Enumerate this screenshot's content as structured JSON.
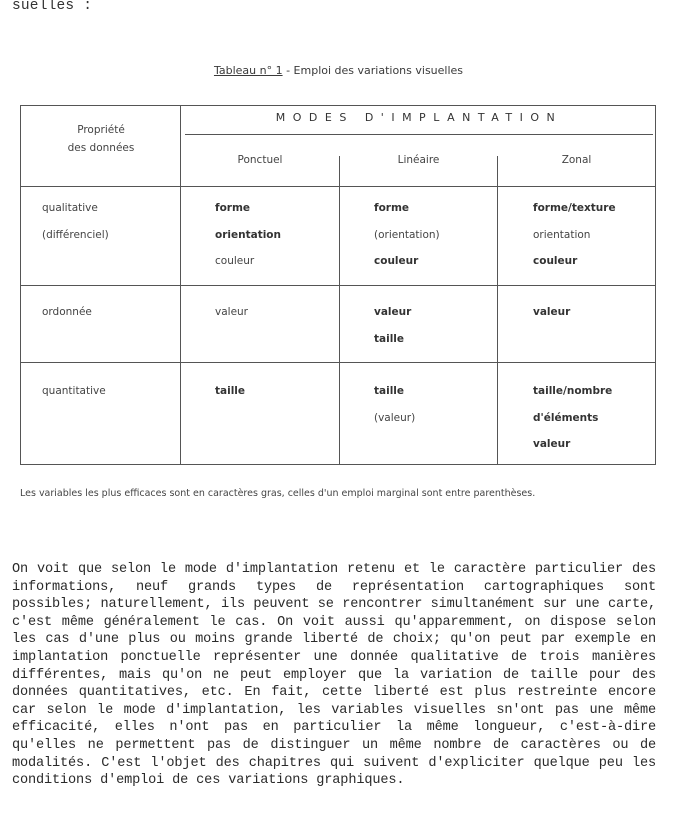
{
  "page": {
    "top_fragment": "suelles :",
    "caption": {
      "label": "Tableau n° 1",
      "separator": " - ",
      "title": "Emploi des variations visuelles"
    },
    "table": {
      "row_header_label_line1": "Propriété",
      "row_header_label_line2": "des données",
      "group_header": "MODES D'IMPLANTATION",
      "columns": [
        "Ponctuel",
        "Linéaire",
        "Zonal"
      ],
      "rows": [
        {
          "property": [
            "qualitative",
            "(différenciel)"
          ],
          "ponctuel": [
            {
              "text": "forme",
              "bold": true
            },
            {
              "text": "orientation",
              "bold": true
            },
            {
              "text": "couleur",
              "bold": false
            }
          ],
          "lineaire": [
            {
              "text": "forme",
              "bold": true
            },
            {
              "text": "(orientation)",
              "bold": false
            },
            {
              "text": "couleur",
              "bold": true
            }
          ],
          "zonal": [
            {
              "text": "forme/texture",
              "bold": true
            },
            {
              "text": "orientation",
              "bold": false
            },
            {
              "text": "couleur",
              "bold": true
            }
          ]
        },
        {
          "property": [
            "ordonnée"
          ],
          "ponctuel": [
            {
              "text": "valeur",
              "bold": false
            }
          ],
          "lineaire": [
            {
              "text": "valeur",
              "bold": true
            },
            {
              "text": "taille",
              "bold": true
            }
          ],
          "zonal": [
            {
              "text": "valeur",
              "bold": true
            }
          ]
        },
        {
          "property": [
            "quantitative"
          ],
          "ponctuel": [
            {
              "text": "taille",
              "bold": true
            }
          ],
          "lineaire": [
            {
              "text": "taille",
              "bold": true
            },
            {
              "text": "(valeur)",
              "bold": false
            }
          ],
          "zonal": [
            {
              "text": "taille/nombre",
              "bold": true
            },
            {
              "text": "d'éléments",
              "bold": true
            },
            {
              "text": "valeur",
              "bold": true
            }
          ]
        }
      ]
    },
    "footnote": "Les variables les plus efficaces sont en caractères gras, celles d'un emploi marginal sont entre parenthèses.",
    "body_paragraph": "On voit que selon le mode d'implantation retenu et le caractère particulier des informations, neuf grands types de représentation cartographiques sont possibles; naturellement, ils peuvent se rencontrer simultanément sur une carte, c'est même généralement le cas. On voit aussi qu'apparemment, on dispose selon les cas d'une plus ou moins grande liberté de choix;  qu'on peut par exemple en implantation ponctuelle représenter une donnée qualitative de trois manières différentes, mais qu'on ne peut employer que la variation de taille pour des données quantitatives, etc. En fait, cette liberté est plus restreinte encore car selon le mode d'implantation, les variables visuelles sn'ont pas une même efficacité, elles n'ont pas en particulier la même longueur, c'est-à-dire qu'elles ne permettent pas de distinguer un même nombre de caractères ou de modalités. C'est l'objet des chapitres qui suivent d'expliciter quelque peu les conditions d'emploi de ces variations graphiques."
  }
}
